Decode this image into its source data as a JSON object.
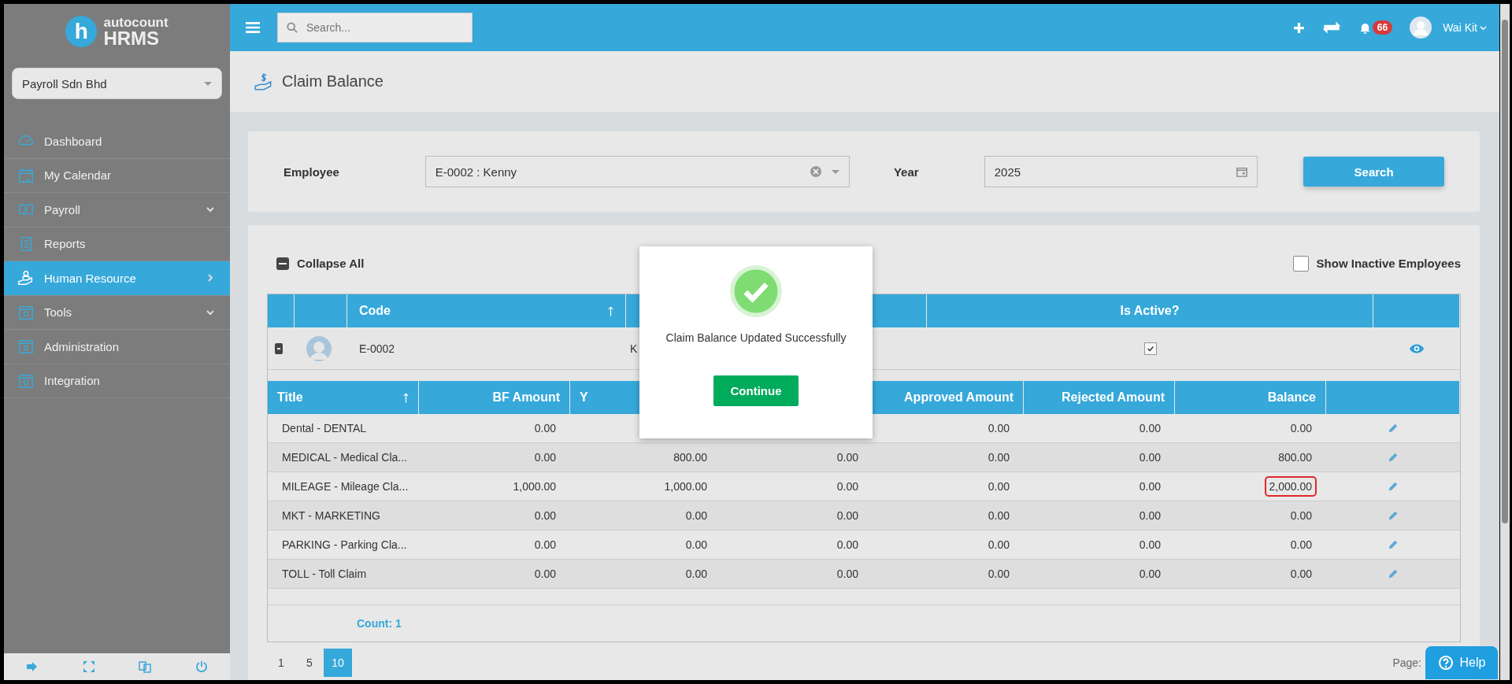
{
  "logo": {
    "letter": "h",
    "brand": "autocount",
    "product": "HRMS"
  },
  "company_select": {
    "value": "Payroll Sdn Bhd"
  },
  "sidebar": {
    "items": [
      {
        "label": "Dashboard",
        "selected": false,
        "has_submenu": false
      },
      {
        "label": "My Calendar",
        "selected": false,
        "has_submenu": false
      },
      {
        "label": "Payroll",
        "selected": false,
        "has_submenu": true
      },
      {
        "label": "Reports",
        "selected": false,
        "has_submenu": false
      },
      {
        "label": "Human Resource",
        "selected": true,
        "has_submenu": true
      },
      {
        "label": "Tools",
        "selected": false,
        "has_submenu": true
      },
      {
        "label": "Administration",
        "selected": false,
        "has_submenu": false
      },
      {
        "label": "Integration",
        "selected": false,
        "has_submenu": false
      }
    ]
  },
  "topbar": {
    "search": {
      "placeholder": "Search..."
    },
    "notifications": "66",
    "user": "Wai Kit"
  },
  "page_title": "Claim Balance",
  "filter": {
    "employee_label": "Employee",
    "employee_value": "E-0002 : Kenny",
    "year_label": "Year",
    "year_value": "2025",
    "search_button": "Search"
  },
  "collapse_all": "Collapse All",
  "show_inactive": {
    "label": "Show Inactive Employees",
    "checked": false
  },
  "employee_table": {
    "columns": [
      "Code",
      "",
      "Is Active?"
    ],
    "rows": [
      {
        "code": "E-0002",
        "name": "K",
        "active": true,
        "expanded": true
      }
    ]
  },
  "claim_table": {
    "columns": [
      "Title",
      "BF Amount",
      "Y",
      "",
      "Approved Amount",
      "Rejected Amount",
      "Balance"
    ],
    "rows": [
      {
        "cells": [
          "Dental - DENTAL",
          "0.00",
          null,
          null,
          "0.00",
          "0.00",
          "0.00"
        ],
        "highlighted": false
      },
      {
        "cells": [
          "MEDICAL - Medical Cla...",
          "0.00",
          "800.00",
          "0.00",
          "0.00",
          "0.00",
          "800.00"
        ],
        "highlighted": false
      },
      {
        "cells": [
          "MILEAGE - Mileage Cla...",
          "1,000.00",
          "1,000.00",
          "0.00",
          "0.00",
          "0.00",
          "2,000.00"
        ],
        "highlighted": true
      },
      {
        "cells": [
          "MKT - MARKETING",
          "0.00",
          "0.00",
          "0.00",
          "0.00",
          "0.00",
          "0.00"
        ],
        "highlighted": false
      },
      {
        "cells": [
          "PARKING - Parking Cla...",
          "0.00",
          "0.00",
          "0.00",
          "0.00",
          "0.00",
          "0.00"
        ],
        "highlighted": false
      },
      {
        "cells": [
          "TOLL - Toll Claim",
          "0.00",
          "0.00",
          "0.00",
          "0.00",
          "0.00",
          "0.00"
        ],
        "highlighted": false
      }
    ]
  },
  "count": "Count: 1",
  "page_sizes": [
    {
      "label": "1",
      "selected": false
    },
    {
      "label": "5",
      "selected": false
    },
    {
      "label": "10",
      "selected": true
    }
  ],
  "page_label": "Page:",
  "help": "Help",
  "modal": {
    "message": "Claim Balance Updated Successfully",
    "button": "Continue"
  }
}
